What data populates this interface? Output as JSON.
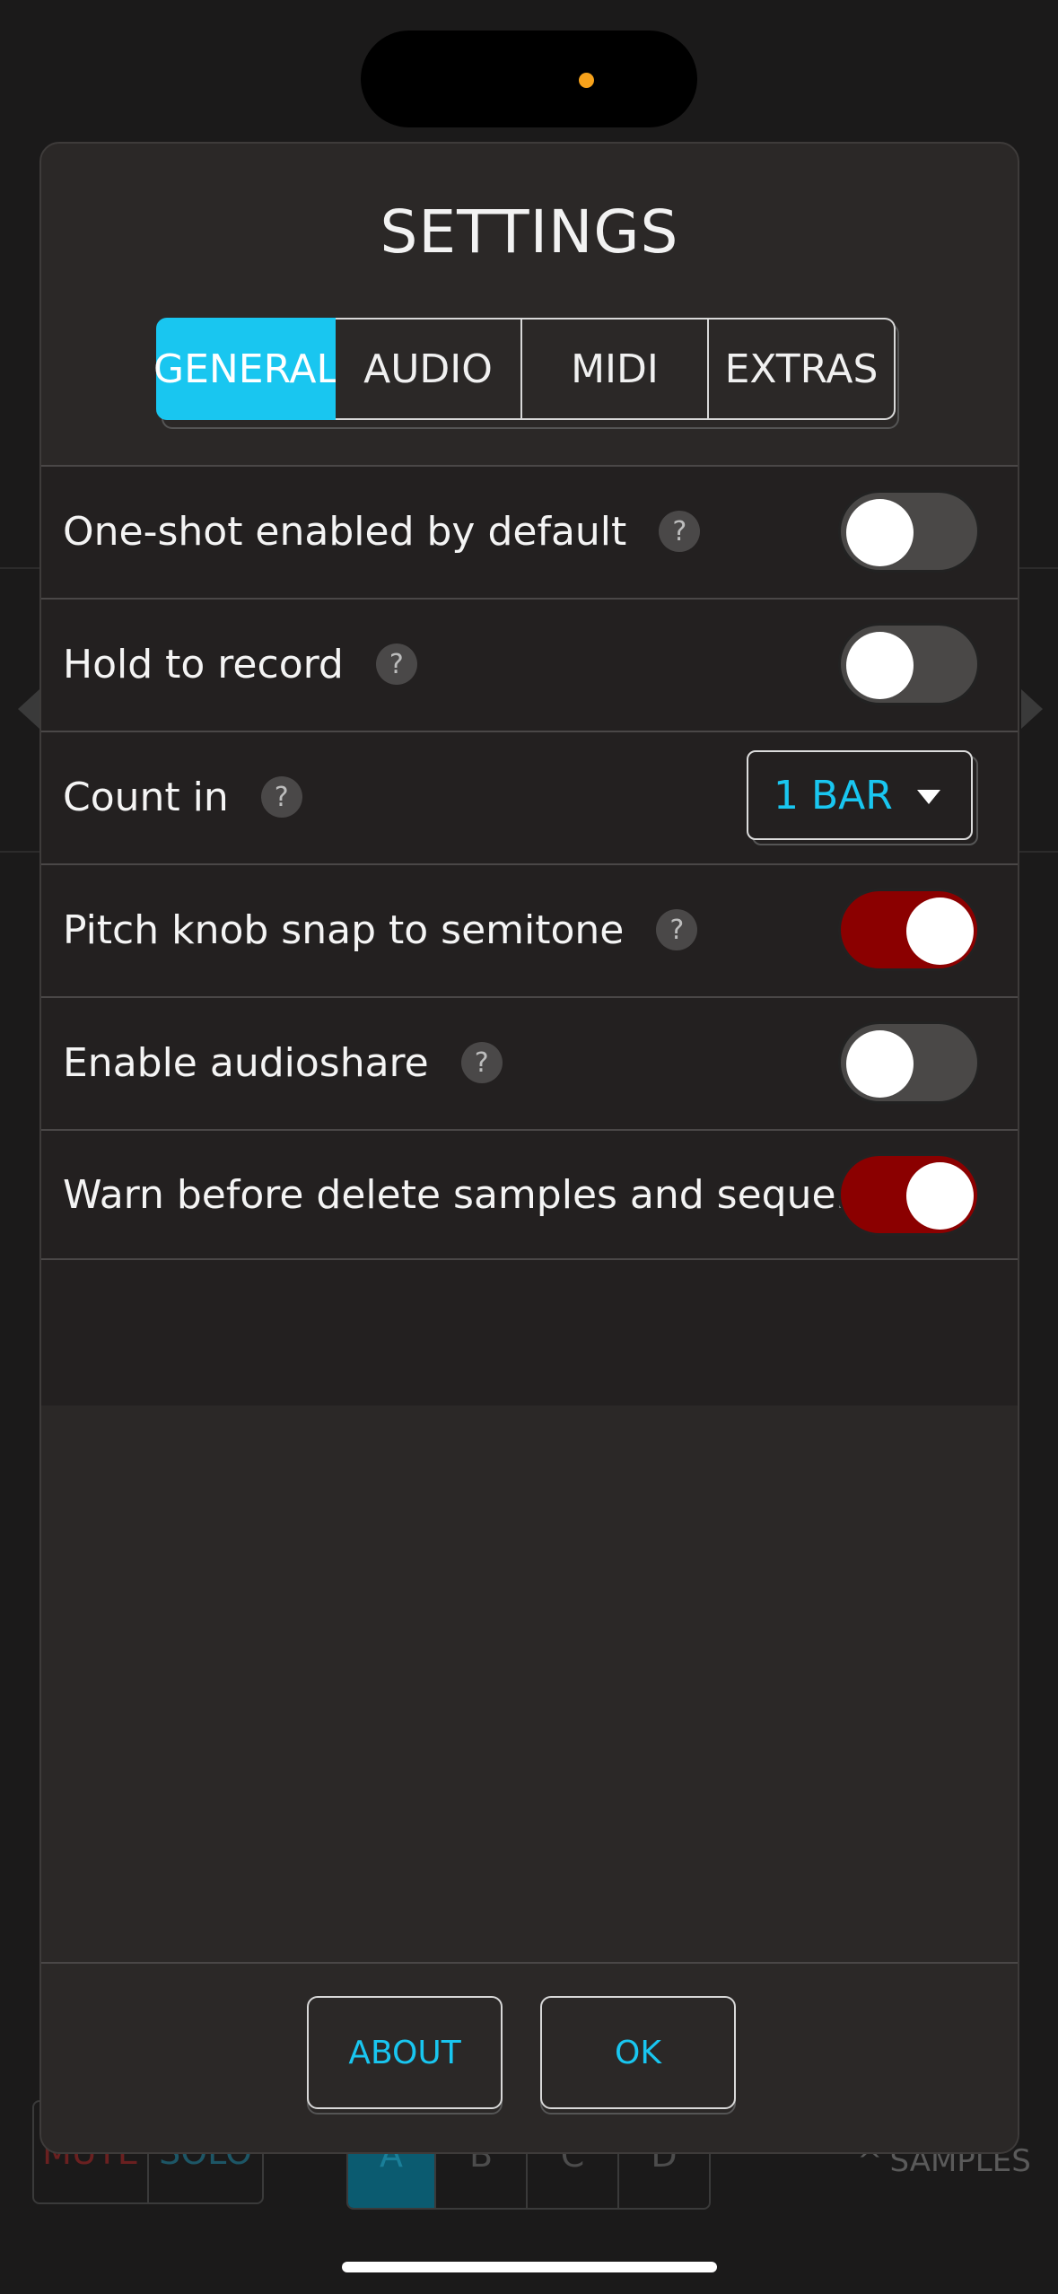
{
  "modal": {
    "title": "SETTINGS",
    "tabs": [
      {
        "label": "GENERAL",
        "active": true
      },
      {
        "label": "AUDIO",
        "active": false
      },
      {
        "label": "MIDI",
        "active": false
      },
      {
        "label": "EXTRAS",
        "active": false
      }
    ],
    "rows": [
      {
        "label": "One-shot enabled by default",
        "help": "?",
        "toggle_on": false
      },
      {
        "label": "Hold to record",
        "help": "?",
        "toggle_on": false
      },
      {
        "label": "Count in",
        "help": "?",
        "select_value": "1 BAR"
      },
      {
        "label": "Pitch knob snap to semitone",
        "help": "?",
        "toggle_on": true
      },
      {
        "label": "Enable audioshare",
        "help": "?",
        "toggle_on": false
      },
      {
        "label": "Warn before delete samples and sequences",
        "toggle_on": true
      }
    ],
    "footer": {
      "about_label": "ABOUT",
      "ok_label": "OK"
    }
  },
  "background": {
    "mute_label": "MUTE",
    "solo_label": "SOLO",
    "banks": [
      "A",
      "B",
      "C",
      "D"
    ],
    "samples_label": "SAMPLES"
  },
  "colors": {
    "accent": "#19c6f0",
    "toggle_on": "#8b0000",
    "toggle_off": "#4a4847",
    "status_dot": "#f7a21b"
  }
}
